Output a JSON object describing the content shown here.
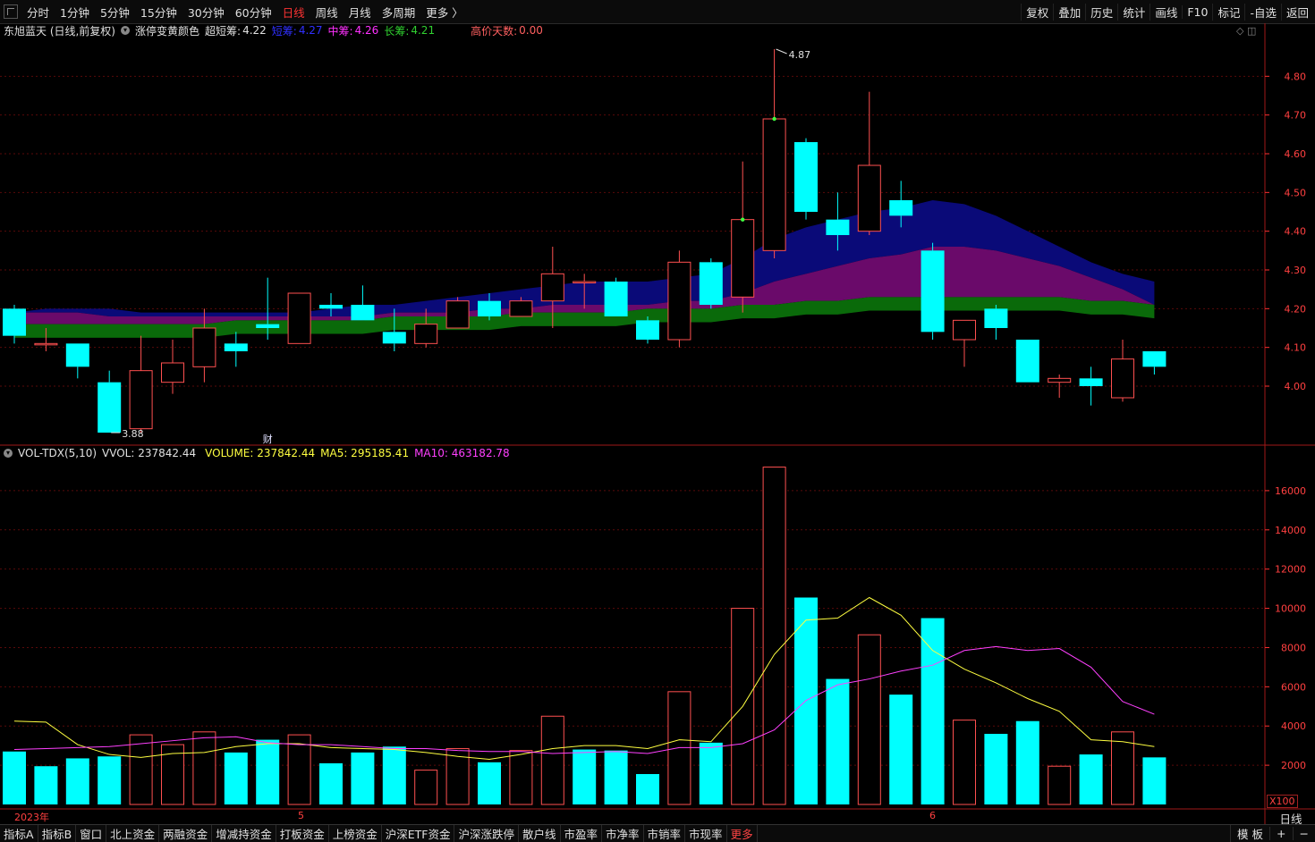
{
  "toolbar": {
    "left": [
      "分时",
      "1分钟",
      "5分钟",
      "15分钟",
      "30分钟",
      "60分钟",
      "日线",
      "周线",
      "月线",
      "多周期",
      "更多 〉"
    ],
    "active": "日线",
    "right": [
      "复权",
      "叠加",
      "历史",
      "统计",
      "画线",
      "F10",
      "标记",
      "-自选",
      "返回"
    ]
  },
  "header": {
    "title": "东旭蓝天 (日线,前复权)",
    "indicator_name": "涨停变黄颜色",
    "ultra_short_label": "超短筹:",
    "ultra_short_value": "4.22",
    "short_label": "短筹:",
    "short_value": "4.27",
    "mid_label": "中筹:",
    "mid_value": "4.26",
    "long_label": "长筹:",
    "long_value": "4.21",
    "high_days_label": "高价天数:",
    "high_days_value": "0.00"
  },
  "volume_header": {
    "name": "VOL-TDX(5,10)",
    "vvol": "VVOL: 237842.44",
    "volume": "VOLUME: 237842.44",
    "ma5": "MA5: 295185.41",
    "ma10": "MA10: 463182.78"
  },
  "annotations": {
    "high": "4.87",
    "low": "3.88",
    "fin_marker": "财"
  },
  "dates": {
    "start": "2023年",
    "may": "5",
    "june": "6"
  },
  "period": "日线",
  "x100": "X100",
  "bottom_tabs": [
    "指标A",
    "指标B",
    "窗口",
    "北上资金",
    "两融资金",
    "增减持资金",
    "打板资金",
    "上榜资金",
    "沪深ETF资金",
    "沪深涨跌停",
    "散户线",
    "市盈率",
    "市净率",
    "市销率",
    "市现率",
    "更多"
  ],
  "bottom_right": [
    "模 板",
    "+",
    "−"
  ],
  "colors": {
    "up": "#ff5050",
    "down": "#00ffff",
    "bg": "#000000",
    "axis": "#ff3030",
    "ma5": "#ffff40",
    "ma10": "#ff40ff"
  },
  "chart_data": [
    {
      "type": "candlestick",
      "title": "",
      "ylim": [
        3.85,
        4.9
      ],
      "y_ticks": [
        "4.00",
        "4.10",
        "4.20",
        "4.30",
        "4.40",
        "4.50",
        "4.60",
        "4.70",
        "4.80"
      ],
      "candles": [
        {
          "o": 4.2,
          "h": 4.21,
          "l": 4.11,
          "c": 4.13
        },
        {
          "o": 4.11,
          "h": 4.15,
          "l": 4.09,
          "c": 4.11
        },
        {
          "o": 4.11,
          "h": 4.11,
          "l": 4.02,
          "c": 4.05
        },
        {
          "o": 4.01,
          "h": 4.04,
          "l": 3.88,
          "c": 3.88
        },
        {
          "o": 3.89,
          "h": 4.13,
          "l": 3.88,
          "c": 4.04
        },
        {
          "o": 4.01,
          "h": 4.12,
          "l": 3.98,
          "c": 4.06
        },
        {
          "o": 4.05,
          "h": 4.2,
          "l": 4.01,
          "c": 4.15
        },
        {
          "o": 4.11,
          "h": 4.14,
          "l": 4.05,
          "c": 4.09
        },
        {
          "o": 4.16,
          "h": 4.28,
          "l": 4.12,
          "c": 4.15
        },
        {
          "o": 4.11,
          "h": 4.24,
          "l": 4.11,
          "c": 4.24
        },
        {
          "o": 4.21,
          "h": 4.24,
          "l": 4.18,
          "c": 4.2
        },
        {
          "o": 4.21,
          "h": 4.26,
          "l": 4.17,
          "c": 4.17
        },
        {
          "o": 4.14,
          "h": 4.2,
          "l": 4.09,
          "c": 4.11
        },
        {
          "o": 4.11,
          "h": 4.2,
          "l": 4.1,
          "c": 4.16
        },
        {
          "o": 4.15,
          "h": 4.23,
          "l": 4.15,
          "c": 4.22
        },
        {
          "o": 4.22,
          "h": 4.24,
          "l": 4.17,
          "c": 4.18
        },
        {
          "o": 4.18,
          "h": 4.23,
          "l": 4.18,
          "c": 4.22
        },
        {
          "o": 4.22,
          "h": 4.36,
          "l": 4.15,
          "c": 4.29
        },
        {
          "o": 4.27,
          "h": 4.29,
          "l": 4.2,
          "c": 4.27
        },
        {
          "o": 4.27,
          "h": 4.28,
          "l": 4.18,
          "c": 4.18
        },
        {
          "o": 4.17,
          "h": 4.18,
          "l": 4.11,
          "c": 4.12
        },
        {
          "o": 4.12,
          "h": 4.35,
          "l": 4.1,
          "c": 4.32
        },
        {
          "o": 4.32,
          "h": 4.33,
          "l": 4.2,
          "c": 4.21
        },
        {
          "o": 4.23,
          "h": 4.58,
          "l": 4.19,
          "c": 4.43
        },
        {
          "o": 4.35,
          "h": 4.87,
          "l": 4.33,
          "c": 4.69
        },
        {
          "o": 4.63,
          "h": 4.64,
          "l": 4.43,
          "c": 4.45
        },
        {
          "o": 4.43,
          "h": 4.5,
          "l": 4.35,
          "c": 4.39
        },
        {
          "o": 4.4,
          "h": 4.76,
          "l": 4.39,
          "c": 4.57
        },
        {
          "o": 4.48,
          "h": 4.53,
          "l": 4.41,
          "c": 4.44
        },
        {
          "o": 4.35,
          "h": 4.37,
          "l": 4.12,
          "c": 4.14
        },
        {
          "o": 4.12,
          "h": 4.17,
          "l": 4.05,
          "c": 4.17
        },
        {
          "o": 4.2,
          "h": 4.21,
          "l": 4.12,
          "c": 4.15
        },
        {
          "o": 4.12,
          "h": 4.12,
          "l": 4.01,
          "c": 4.01
        },
        {
          "o": 4.01,
          "h": 4.03,
          "l": 3.97,
          "c": 4.02
        },
        {
          "o": 4.02,
          "h": 4.05,
          "l": 3.95,
          "c": 4.0
        },
        {
          "o": 3.97,
          "h": 4.12,
          "l": 3.96,
          "c": 4.07
        },
        {
          "o": 4.09,
          "h": 4.09,
          "l": 4.03,
          "c": 4.05
        }
      ],
      "bands": {
        "long": [
          4.16,
          4.16,
          4.16,
          4.16,
          4.16,
          4.16,
          4.16,
          4.17,
          4.17,
          4.17,
          4.17,
          4.17,
          4.18,
          4.18,
          4.18,
          4.18,
          4.19,
          4.19,
          4.19,
          4.19,
          4.2,
          4.2,
          4.2,
          4.21,
          4.21,
          4.22,
          4.22,
          4.23,
          4.23,
          4.23,
          4.23,
          4.23,
          4.23,
          4.23,
          4.22,
          4.22,
          4.21
        ],
        "mid": [
          4.19,
          4.19,
          4.19,
          4.18,
          4.18,
          4.18,
          4.18,
          4.18,
          4.18,
          4.18,
          4.18,
          4.18,
          4.19,
          4.19,
          4.19,
          4.2,
          4.2,
          4.21,
          4.21,
          4.21,
          4.21,
          4.22,
          4.22,
          4.24,
          4.27,
          4.29,
          4.31,
          4.33,
          4.34,
          4.36,
          4.36,
          4.35,
          4.33,
          4.31,
          4.28,
          4.25,
          4.21
        ],
        "short": [
          4.19,
          4.2,
          4.2,
          4.2,
          4.19,
          4.19,
          4.19,
          4.19,
          4.19,
          4.19,
          4.2,
          4.21,
          4.21,
          4.22,
          4.23,
          4.24,
          4.25,
          4.26,
          4.27,
          4.27,
          4.27,
          4.28,
          4.29,
          4.33,
          4.38,
          4.41,
          4.43,
          4.45,
          4.46,
          4.48,
          4.47,
          4.44,
          4.4,
          4.36,
          4.32,
          4.29,
          4.27
        ]
      },
      "events": {
        "high_label_index": 24,
        "low_label_index": 3,
        "fin_marker_index": 8
      }
    },
    {
      "type": "bar",
      "title": "",
      "ylim": [
        0,
        17500
      ],
      "y_ticks": [
        "2000",
        "4000",
        "6000",
        "8000",
        "10000",
        "12000",
        "14000",
        "16000"
      ],
      "unit": "X100",
      "values": [
        2700,
        1950,
        2350,
        2450,
        3550,
        3050,
        3700,
        2650,
        3300,
        3550,
        2100,
        2650,
        2950,
        1750,
        2850,
        2150,
        2750,
        4500,
        2800,
        2750,
        1550,
        5750,
        3150,
        10000,
        17200,
        10550,
        6400,
        8650,
        5600,
        9500,
        4300,
        3600,
        4250,
        1950,
        2550,
        3700,
        2400
      ],
      "up": [
        false,
        false,
        false,
        false,
        true,
        true,
        true,
        false,
        false,
        true,
        false,
        false,
        false,
        true,
        true,
        false,
        true,
        true,
        false,
        false,
        false,
        true,
        false,
        true,
        true,
        false,
        false,
        true,
        false,
        false,
        true,
        false,
        false,
        true,
        false,
        true,
        false
      ],
      "series": [
        {
          "name": "MA5",
          "values": [
            4250,
            4200,
            3050,
            2550,
            2400,
            2600,
            2650,
            2950,
            3100,
            3100,
            2900,
            2850,
            2800,
            2650,
            2450,
            2300,
            2550,
            2850,
            3000,
            3000,
            2850,
            3300,
            3200,
            5000,
            7650,
            9400,
            9500,
            10550,
            9650,
            7850,
            6900,
            6200,
            5400,
            4750,
            3300,
            3200,
            2950
          ]
        },
        {
          "name": "MA10",
          "values": [
            2800,
            2850,
            2900,
            2950,
            3100,
            3250,
            3400,
            3450,
            3150,
            3050,
            3050,
            2950,
            2850,
            2850,
            2750,
            2700,
            2700,
            2600,
            2650,
            2700,
            2600,
            2900,
            2900,
            3100,
            3800,
            5300,
            6100,
            6400,
            6800,
            7100,
            7850,
            8050,
            7850,
            7950,
            7000,
            5250,
            4600
          ]
        }
      ]
    }
  ]
}
